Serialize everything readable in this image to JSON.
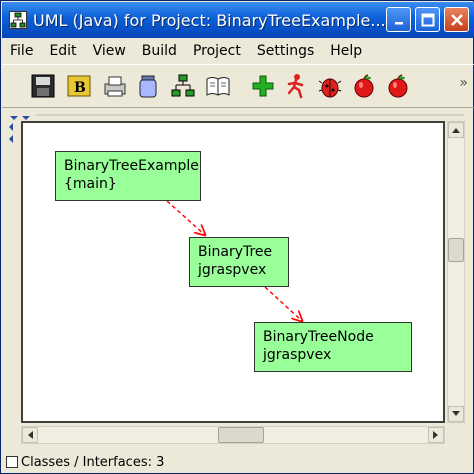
{
  "window": {
    "title": "UML (Java) for Project: BinaryTreeExample...",
    "app_icon": "uml-diagram-icon",
    "controls": [
      "minimize-icon",
      "maximize-icon",
      "close-icon"
    ]
  },
  "menu": {
    "items": [
      {
        "label": "File"
      },
      {
        "label": "Edit"
      },
      {
        "label": "View"
      },
      {
        "label": "Build"
      },
      {
        "label": "Project"
      },
      {
        "label": "Settings"
      },
      {
        "label": "Help"
      }
    ]
  },
  "toolbar": {
    "tools": [
      "save-icon",
      "bytecode-icon",
      "print-icon",
      "jar-icon",
      "hierarchy-icon",
      "book-icon",
      "add-icon",
      "run-icon",
      "debug-icon",
      "apple-icon",
      "apple-icon-2"
    ],
    "more": "»"
  },
  "diagram": {
    "node_color": "#99ff99",
    "edge_color": "#ff0000",
    "nodes": [
      {
        "name": "BinaryTreeExample",
        "detail": "{main}"
      },
      {
        "name": "BinaryTree",
        "detail": "jgraspvex"
      },
      {
        "name": "BinaryTreeNode",
        "detail": "jgraspvex"
      }
    ]
  },
  "status": {
    "text": "Classes / Interfaces: 3"
  }
}
